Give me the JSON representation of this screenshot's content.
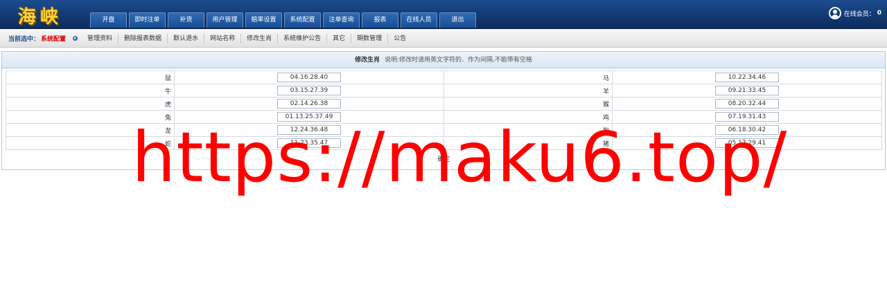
{
  "header": {
    "logo": "海峡",
    "nav": [
      "开盘",
      "即时注单",
      "补货",
      "用户管理",
      "赔率设置",
      "系统配置",
      "注单查询",
      "报表",
      "在线人员",
      "退出"
    ],
    "online_label": "在线会员：",
    "online_count": "0"
  },
  "subnav": {
    "current_label": "当前选中：",
    "current_value": "系统配置",
    "items": [
      "管理资料",
      "删除报表数据",
      "默认退水",
      "网站名称",
      "修改生肖",
      "系统维护公告",
      "其它",
      "期数管理",
      "公告"
    ]
  },
  "panel": {
    "title": "修改生肖",
    "note": "说明:修改时请用英文字符的．作为间隔,不能带有空格",
    "rows": [
      {
        "left_label": "鼠",
        "left_value": "04.16.28.40",
        "right_label": "马",
        "right_value": "10.22.34.46"
      },
      {
        "left_label": "牛",
        "left_value": "03.15.27.39",
        "right_label": "羊",
        "right_value": "09.21.33.45"
      },
      {
        "left_label": "虎",
        "left_value": "02.14.26.38",
        "right_label": "猴",
        "right_value": "08.20.32.44"
      },
      {
        "left_label": "兔",
        "left_value": "01.13.25.37.49",
        "right_label": "鸡",
        "right_value": "07.19.31.43"
      },
      {
        "left_label": "龙",
        "left_value": "12.24.36.48",
        "right_label": "狗",
        "right_value": "06.18.30.42"
      },
      {
        "left_label": "蛇",
        "left_value": "11.23.35.47",
        "right_label": "猪",
        "right_value": "05.17.29.41"
      }
    ],
    "confirm_label": "确定"
  },
  "watermark": "https://maku6.top/"
}
